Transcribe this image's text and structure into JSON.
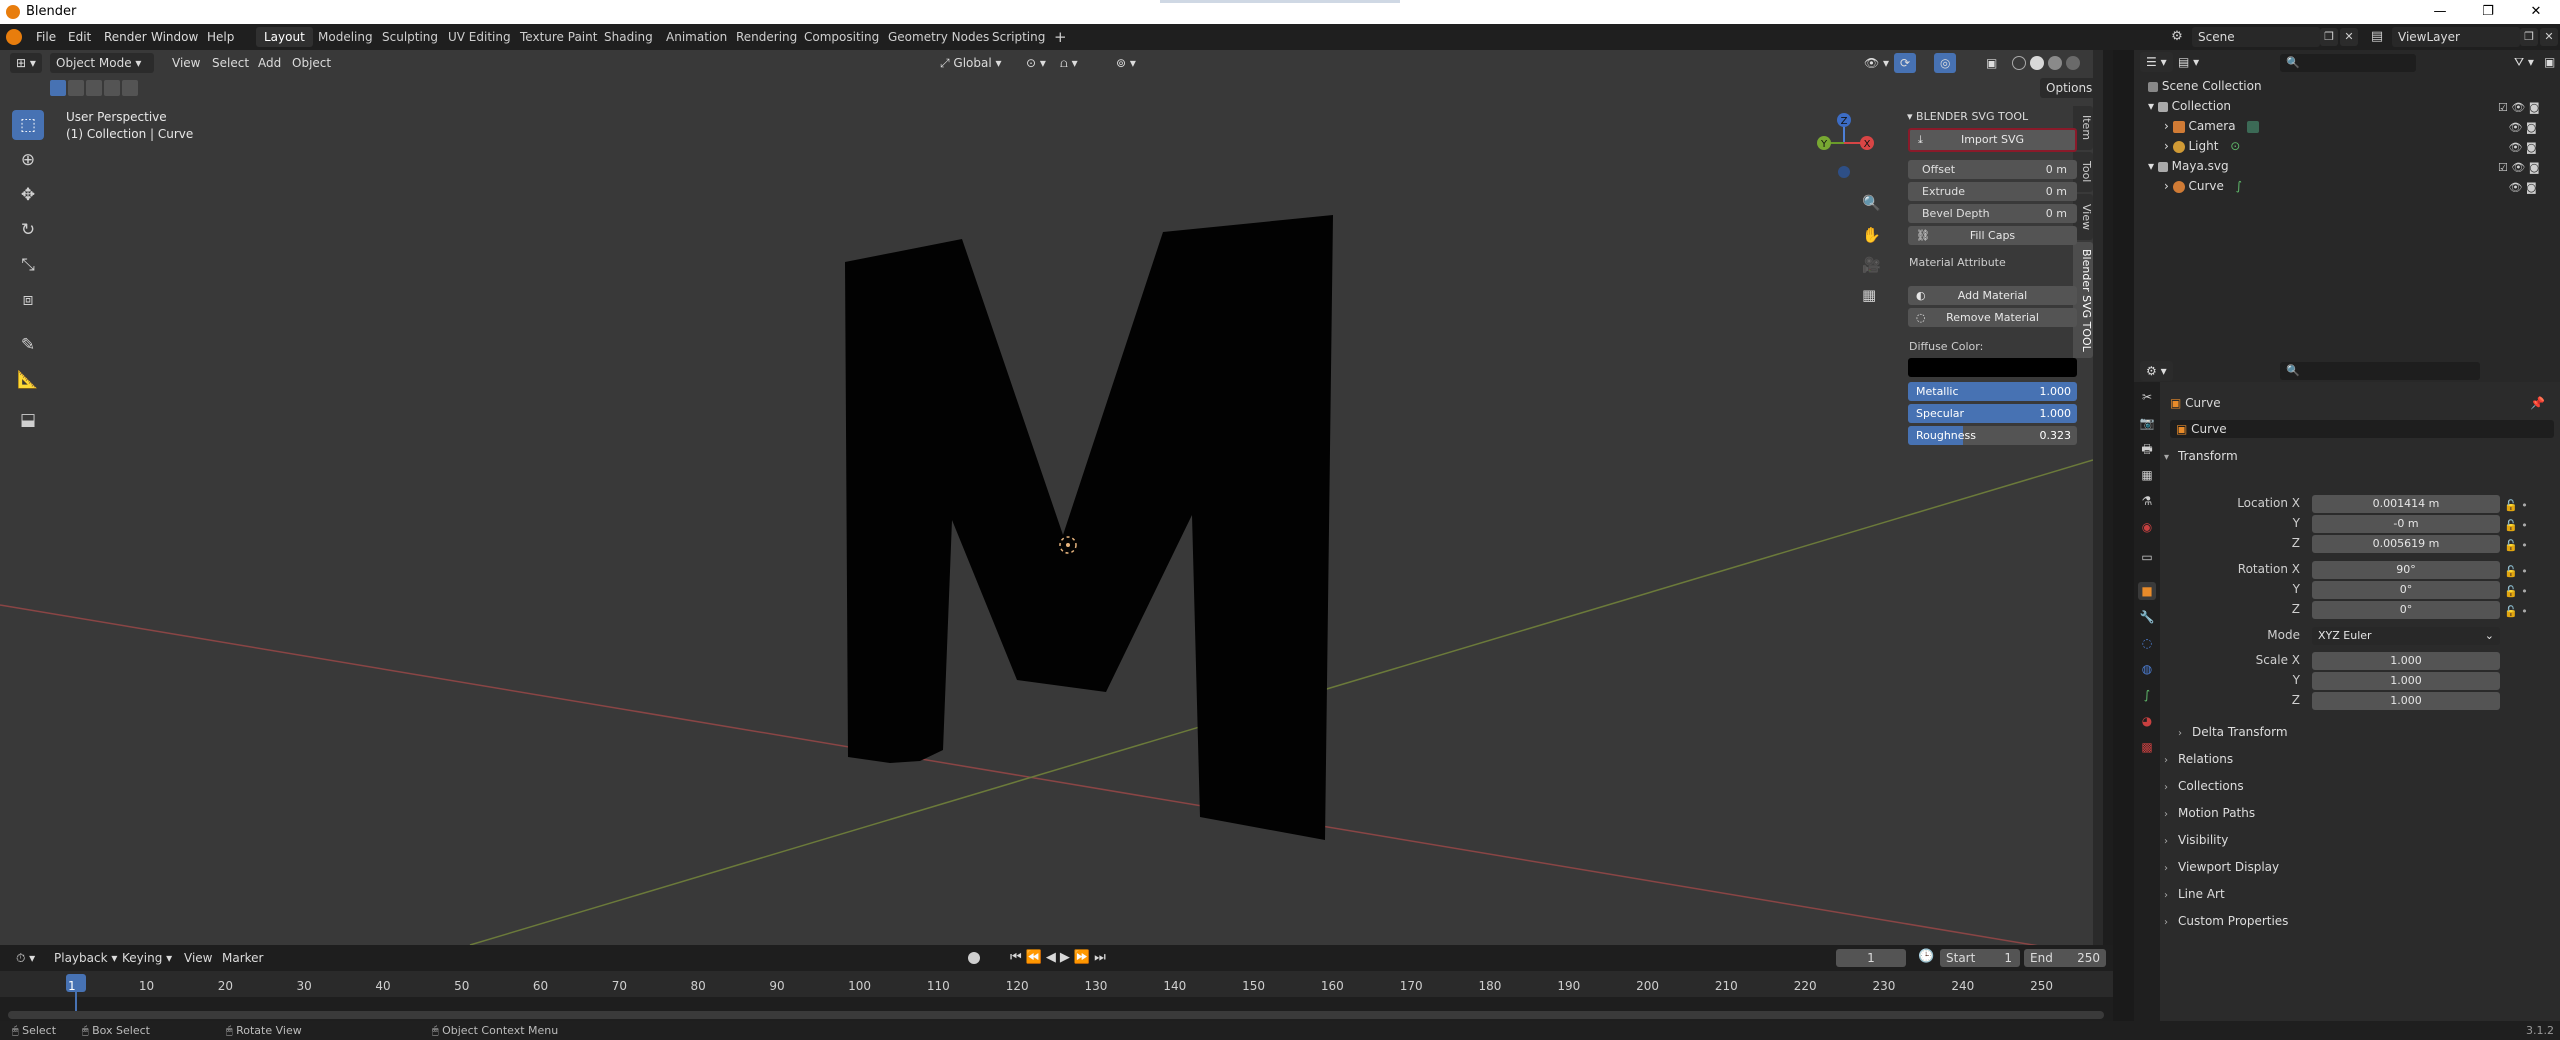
{
  "window": {
    "title": "Blender",
    "controls": [
      "—",
      "❐",
      "✕"
    ]
  },
  "menu": [
    "File",
    "Edit",
    "Render",
    "Window",
    "Help"
  ],
  "workspaces": [
    "Layout",
    "Modeling",
    "Sculpting",
    "UV Editing",
    "Texture Paint",
    "Shading",
    "Animation",
    "Rendering",
    "Compositing",
    "Geometry Nodes",
    "Scripting"
  ],
  "active_workspace": "Layout",
  "scene": "Scene",
  "view_layer": "ViewLayer",
  "viewport": {
    "mode": "Object Mode",
    "menus": [
      "View",
      "Select",
      "Add",
      "Object"
    ],
    "orientation": "Global",
    "options_label": "Options",
    "info_line1": "User Perspective",
    "info_line2": "(1) Collection | Curve",
    "tabs": [
      "Item",
      "Tool",
      "View",
      "Blender SVG TOOL"
    ],
    "active_tab": "Blender SVG TOOL",
    "gizmo": {
      "x": "X",
      "y": "Y",
      "z": "Z"
    }
  },
  "svg_panel": {
    "header": "BLENDER SVG TOOL",
    "import_button": "Import SVG",
    "offset_label": "Offset",
    "offset_value": "0 m",
    "extrude_label": "Extrude",
    "extrude_value": "0 m",
    "bevel_label": "Bevel Depth",
    "bevel_value": "0 m",
    "fill_caps": "Fill Caps",
    "material_attribute": "Material Attribute",
    "add_material": "Add Material",
    "remove_material": "Remove Material",
    "diffuse_label": "Diffuse Color:",
    "diffuse_color": "#000000",
    "metallic_label": "Metallic",
    "metallic_value": "1.000",
    "specular_label": "Specular",
    "specular_value": "1.000",
    "roughness_label": "Roughness",
    "roughness_value": "0.323",
    "roughness_fraction": 0.323
  },
  "timeline": {
    "menus": [
      "Playback",
      "Keying",
      "View",
      "Marker"
    ],
    "current_frame": "1",
    "start_label": "Start",
    "start_value": "1",
    "end_label": "End",
    "end_value": "250",
    "ticks": [
      "1",
      "10",
      "20",
      "30",
      "40",
      "50",
      "60",
      "70",
      "80",
      "90",
      "100",
      "110",
      "120",
      "130",
      "140",
      "150",
      "160",
      "170",
      "180",
      "190",
      "200",
      "210",
      "220",
      "230",
      "240",
      "250"
    ]
  },
  "status": {
    "select": "Select",
    "box_select": "Box Select",
    "rotate_view": "Rotate View",
    "context_menu": "Object Context Menu",
    "version": "3.1.2"
  },
  "outliner": {
    "root": "Scene Collection",
    "items": [
      {
        "name": "Collection",
        "indent": 1
      },
      {
        "name": "Camera",
        "indent": 2
      },
      {
        "name": "Light",
        "indent": 2
      },
      {
        "name": "Maya.svg",
        "indent": 1
      },
      {
        "name": "Curve",
        "indent": 2
      }
    ]
  },
  "properties": {
    "object_name": "Curve",
    "data_name": "Curve",
    "transform_label": "Transform",
    "location_label": "Location X",
    "loc_x": "0.001414 m",
    "loc_y": "-0 m",
    "loc_z": "0.005619 m",
    "rotation_label": "Rotation X",
    "rot_x": "90°",
    "rot_y": "0°",
    "rot_z": "0°",
    "mode_label": "Mode",
    "mode_value": "XYZ Euler",
    "scale_label": "Scale X",
    "scale_x": "1.000",
    "scale_y": "1.000",
    "scale_z": "1.000",
    "y_label": "Y",
    "z_label": "Z",
    "delta_transform": "Delta Transform",
    "sections": [
      "Relations",
      "Collections",
      "Motion Paths",
      "Visibility",
      "Viewport Display",
      "Line Art",
      "Custom Properties"
    ]
  }
}
